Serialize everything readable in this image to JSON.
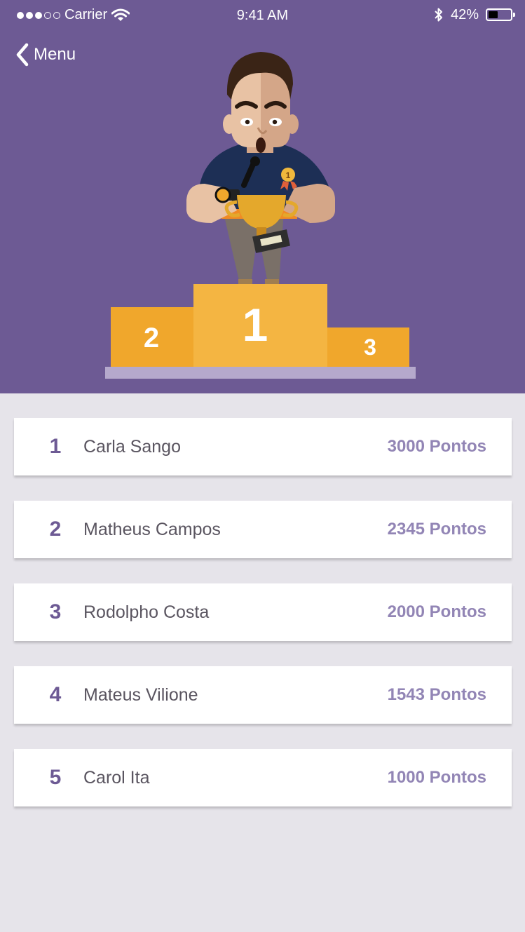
{
  "status_bar": {
    "carrier": "Carrier",
    "time": "9:41 AM",
    "battery": "42%",
    "battery_level": 0.42,
    "signal_bars_filled": 3,
    "signal_bars_total": 5
  },
  "nav": {
    "back_label": "Menu",
    "back_icon": "chevron-left-icon"
  },
  "podium": {
    "first": "1",
    "second": "2",
    "third": "3"
  },
  "ranking": [
    {
      "position": "1",
      "name": "Carla Sango",
      "points": "3000 Pontos"
    },
    {
      "position": "2",
      "name": "Matheus Campos",
      "points": "2345 Pontos"
    },
    {
      "position": "3",
      "name": "Rodolpho Costa",
      "points": "2000 Pontos"
    },
    {
      "position": "4",
      "name": "Mateus Vilione",
      "points": "1543 Pontos"
    },
    {
      "position": "5",
      "name": "Carol Ita",
      "points": "1000 Pontos"
    }
  ],
  "colors": {
    "header_bg": "#6d5a94",
    "page_bg": "#e6e4ea",
    "podium_gold": "#f0a72c",
    "position_text": "#6d5a94",
    "points_text": "#9285b5"
  }
}
